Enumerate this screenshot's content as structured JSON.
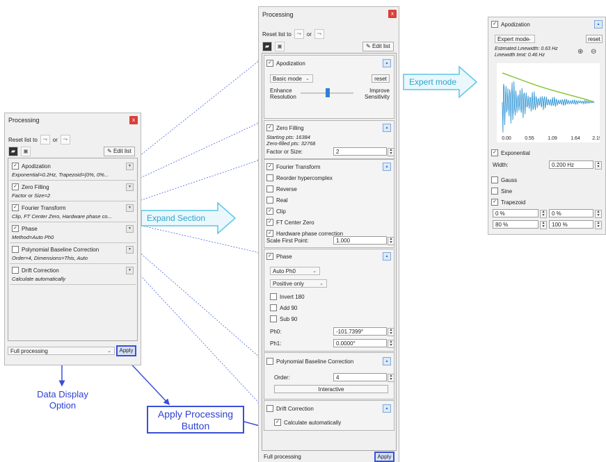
{
  "left_panel": {
    "title": "Processing",
    "close": "x",
    "reset_label": "Reset list to",
    "or_label": "or",
    "edit_list": "Edit list",
    "sections": [
      {
        "name": "Apodization",
        "checked": true,
        "summary": "Exponential=0.2Hz, Trapezoid=(0%, 0%..."
      },
      {
        "name": "Zero Filling",
        "checked": true,
        "summary": "Factor or Size=2"
      },
      {
        "name": "Fourier Transform",
        "checked": true,
        "summary": "Clip, FT Center Zero, Hardware phase co..."
      },
      {
        "name": "Phase",
        "checked": true,
        "summary": "Method=Auto Ph0"
      },
      {
        "name": "Polynomial Baseline Correction",
        "checked": false,
        "summary": "Order=4, Dimensions=This, Auto"
      },
      {
        "name": "Drift Correction",
        "checked": false,
        "summary": "Calculate automatically"
      }
    ],
    "mode": "Full processing",
    "apply": "Apply"
  },
  "mid_panel": {
    "title": "Processing",
    "close": "x",
    "reset_label": "Reset list to",
    "or_label": "or",
    "edit_list": "Edit list",
    "apodization": {
      "label": "Apodization",
      "mode": "Basic mode",
      "reset": "reset",
      "enhance": "Enhance\nResolution",
      "improve": "Improve\nSensitivity"
    },
    "zero_filling": {
      "label": "Zero Filling",
      "starting": "Starting pts: 16384",
      "zero_filled": "Zero-filled pts: 32768",
      "factor_label": "Factor or Size:",
      "factor_value": "2"
    },
    "fourier": {
      "label": "Fourier Transform",
      "options": [
        {
          "label": "Reorder hypercomplex",
          "checked": false
        },
        {
          "label": "Reverse",
          "checked": false
        },
        {
          "label": "Real",
          "checked": false
        },
        {
          "label": "Clip",
          "checked": true
        },
        {
          "label": "FT Center Zero",
          "checked": true
        },
        {
          "label": "Hardware phase correction",
          "checked": true
        }
      ],
      "scale_label": "Scale First Point:",
      "scale_value": "1.000"
    },
    "phase": {
      "label": "Phase",
      "method": "Auto Ph0",
      "sign": "Positive only",
      "options": [
        {
          "label": "Invert 180",
          "checked": false
        },
        {
          "label": "Add 90",
          "checked": false
        },
        {
          "label": "Sub 90",
          "checked": false
        }
      ],
      "ph0_label": "Ph0:",
      "ph0_value": "-101.7399°",
      "ph1_label": "Ph1:",
      "ph1_value": "0.0000°"
    },
    "baseline": {
      "label": "Polynomial Baseline Correction",
      "order_label": "Order:",
      "order_value": "4",
      "interactive": "Interactive"
    },
    "drift": {
      "label": "Drift Correction",
      "calc": "Calculate automatically"
    },
    "mode": "Full processing",
    "apply": "Apply"
  },
  "right_panel": {
    "label": "Apodization",
    "mode": "Expert mode",
    "reset": "reset",
    "est_linewidth": "Estimated Linewidth: 0.63 Hz",
    "linewidth_limit": "Linewidth limit: 0.46 Hz",
    "ticks": [
      "0.00",
      "0.55",
      "1.09",
      "1.64",
      "2.19"
    ],
    "exponential": "Exponential",
    "width_label": "Width:",
    "width_value": "0.200 Hz",
    "gauss": "Gauss",
    "sine": "Sine",
    "trapezoid": "Trapezoid",
    "trap_values": [
      "0 %",
      "0 %",
      "80 %",
      "100 %"
    ]
  },
  "annotations": {
    "expand_section": "Expand Section",
    "expert_mode": "Expert mode",
    "data_display": "Data Display\nOption",
    "apply_button": "Apply Processing\nButton"
  },
  "colors": {
    "callout_blue": "#2a3fd0",
    "arrow_cyan": "#5bc6e6",
    "close_red": "#d9403a",
    "plot_blue": "#2f95d6",
    "plot_green": "#8cc63f"
  }
}
